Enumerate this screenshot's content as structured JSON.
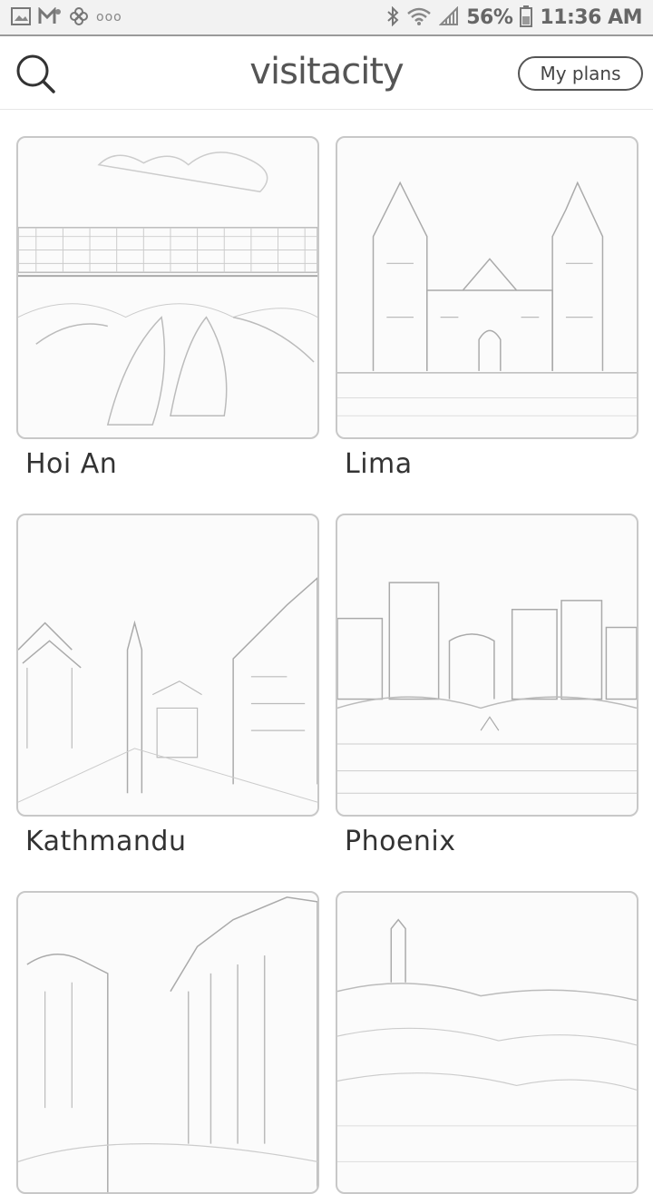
{
  "status_bar": {
    "left_icons": [
      "gallery-icon",
      "gmail-icon",
      "pinwheel-icon"
    ],
    "more": "ooo",
    "battery": "56%",
    "time": "11:36 AM"
  },
  "header": {
    "brand": "visitacity",
    "my_plans_label": "My plans"
  },
  "cities": [
    {
      "name": "Hoi An"
    },
    {
      "name": "Lima"
    },
    {
      "name": "Kathmandu"
    },
    {
      "name": "Phoenix"
    },
    {
      "name": ""
    },
    {
      "name": ""
    }
  ]
}
